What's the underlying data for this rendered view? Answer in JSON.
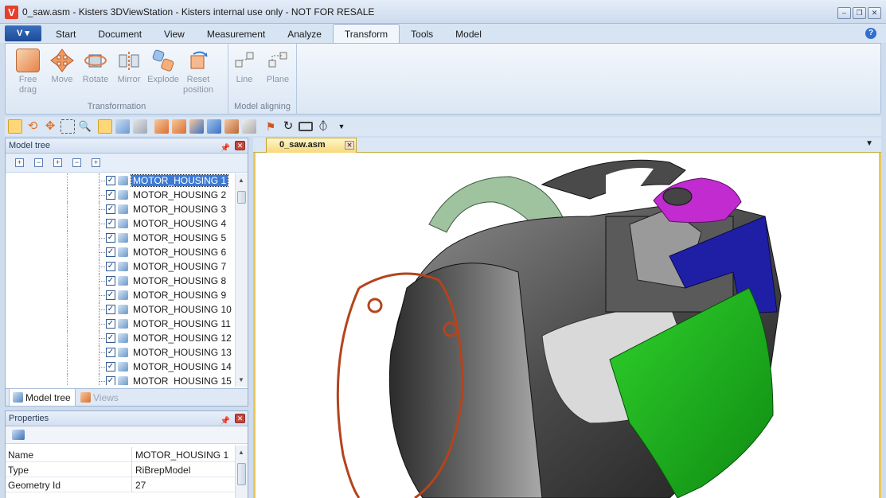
{
  "window": {
    "title": "0_saw.asm - Kisters 3DViewStation - Kisters internal use only - NOT FOR RESALE",
    "logo_letter": "V",
    "controls": [
      "minimize",
      "restore",
      "close"
    ]
  },
  "menu": {
    "app_button": "V",
    "tabs": [
      {
        "label": "Start",
        "active": false
      },
      {
        "label": "Document",
        "active": false
      },
      {
        "label": "View",
        "active": false
      },
      {
        "label": "Measurement",
        "active": false
      },
      {
        "label": "Analyze",
        "active": false
      },
      {
        "label": "Transform",
        "active": true
      },
      {
        "label": "Tools",
        "active": false
      },
      {
        "label": "Model",
        "active": false
      }
    ],
    "help": "?"
  },
  "ribbon": {
    "groups": [
      {
        "label": "Transformation",
        "buttons": [
          {
            "label": "Free\ndrag",
            "icon": "free-drag-icon"
          },
          {
            "label": "Move",
            "icon": "move-icon"
          },
          {
            "label": "Rotate",
            "icon": "rotate-icon"
          },
          {
            "label": "Mirror",
            "icon": "mirror-icon"
          },
          {
            "label": "Explode",
            "icon": "explode-icon"
          },
          {
            "label": "Reset\nposition",
            "icon": "reset-position-icon"
          }
        ]
      },
      {
        "label": "Model aligning",
        "buttons": [
          {
            "label": "Line",
            "icon": "align-line-icon"
          },
          {
            "label": "Plane",
            "icon": "align-plane-icon"
          }
        ]
      }
    ]
  },
  "model_tree": {
    "title": "Model tree",
    "items": [
      {
        "label": "MOTOR_HOUSING 1",
        "checked": true,
        "selected": true
      },
      {
        "label": "MOTOR_HOUSING 2",
        "checked": true,
        "selected": false
      },
      {
        "label": "MOTOR_HOUSING 3",
        "checked": true,
        "selected": false
      },
      {
        "label": "MOTOR_HOUSING 4",
        "checked": true,
        "selected": false
      },
      {
        "label": "MOTOR_HOUSING 5",
        "checked": true,
        "selected": false
      },
      {
        "label": "MOTOR_HOUSING 6",
        "checked": true,
        "selected": false
      },
      {
        "label": "MOTOR_HOUSING 7",
        "checked": true,
        "selected": false
      },
      {
        "label": "MOTOR_HOUSING 8",
        "checked": true,
        "selected": false
      },
      {
        "label": "MOTOR_HOUSING 9",
        "checked": true,
        "selected": false
      },
      {
        "label": "MOTOR_HOUSING 10",
        "checked": true,
        "selected": false
      },
      {
        "label": "MOTOR_HOUSING 11",
        "checked": true,
        "selected": false
      },
      {
        "label": "MOTOR_HOUSING 12",
        "checked": true,
        "selected": false
      },
      {
        "label": "MOTOR_HOUSING 13",
        "checked": true,
        "selected": false
      },
      {
        "label": "MOTOR_HOUSING 14",
        "checked": true,
        "selected": false
      },
      {
        "label": "MOTOR_HOUSING 15",
        "checked": true,
        "selected": false
      }
    ],
    "bottom_tabs": [
      "Model tree",
      "Views"
    ]
  },
  "properties": {
    "title": "Properties",
    "rows": [
      {
        "key": "Name",
        "value": "MOTOR_HOUSING 1"
      },
      {
        "key": "Type",
        "value": "RiBrepModel"
      },
      {
        "key": "Geometry Id",
        "value": "27"
      }
    ]
  },
  "document": {
    "tab_label": "0_saw.asm"
  },
  "colors": {
    "accent": "#3d7ad6",
    "viewport_border": "#e8c85d",
    "part_green": "#19b21a",
    "part_blue": "#1f1fa6",
    "part_magenta": "#c12bd0",
    "gasket_orange": "#b4441c"
  }
}
